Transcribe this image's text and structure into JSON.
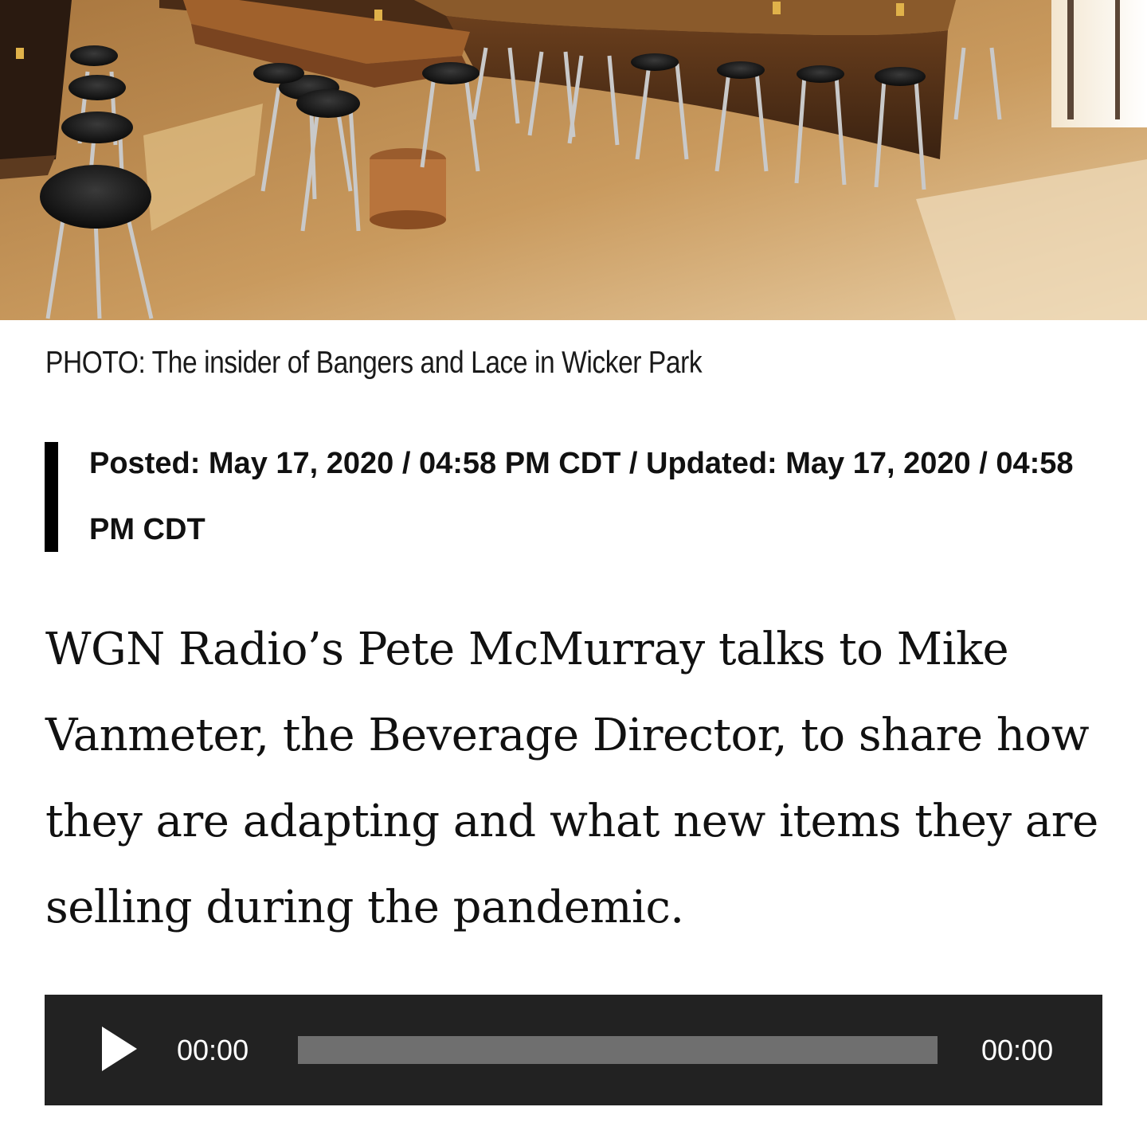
{
  "photo": {
    "description_icon": "bar-interior-photo"
  },
  "caption": "PHOTO: The insider of Bangers and Lace in Wicker Park",
  "meta": {
    "text": "Posted: May 17, 2020 / 04:58 PM CDT / Updated: May 17, 2020 / 04:58 PM CDT"
  },
  "article": {
    "lead": "WGN Radio’s Pete McMurray talks to Mike Vanmeter, the Beverage Director, to share how they are adapting and what new items they are selling during the pandemic."
  },
  "audio_player": {
    "play_icon": "play-icon",
    "current_time": "00:00",
    "duration": "00:00",
    "progress": 0,
    "colors": {
      "background": "#222222",
      "track": "#6f6f6f",
      "text": "#ffffff"
    }
  }
}
